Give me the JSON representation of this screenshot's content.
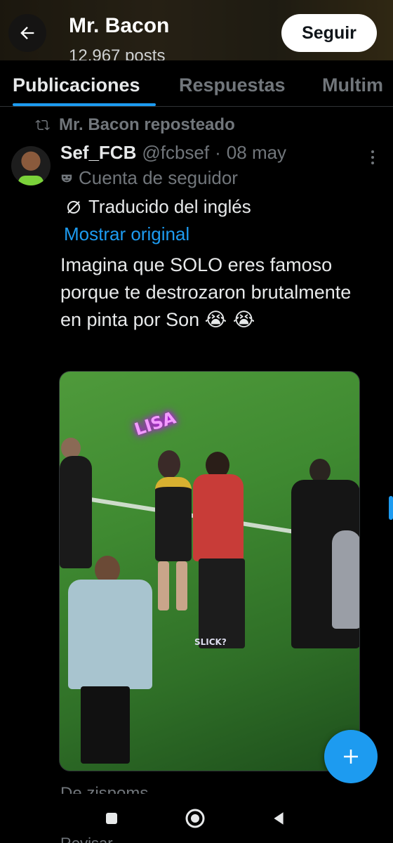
{
  "header": {
    "profile_name": "Mr. Bacon",
    "posts_count": "12.967 posts",
    "follow_label": "Seguir"
  },
  "tabs": [
    {
      "label": "Publicaciones",
      "active": true
    },
    {
      "label": "Respuestas",
      "active": false
    },
    {
      "label": "Multim",
      "active": false
    }
  ],
  "post": {
    "repost_label": "Mr. Bacon reposteado",
    "author_name": "Sef_FCB",
    "author_handle": "@fcbsef",
    "separator": "·",
    "date": "08 may",
    "fan_account_label": "Cuenta de seguidor",
    "translated_label": "Traducido del inglés",
    "show_original_label": "Mostrar original",
    "text": "Imagina que SOLO eres famoso porque te destrozaron brutalmente en pinta por Son",
    "emoji": "😭 😭",
    "media_overlay_tag": "LISA",
    "media_watermark": "SLICK?",
    "source_label": "De zispoms"
  },
  "bottom_text": "Revisar",
  "icons": {
    "back": "back-arrow-icon",
    "repost": "repost-icon",
    "more": "more-vertical-icon",
    "fan": "mask-icon",
    "translate": "translate-icon",
    "compose": "plus-icon"
  },
  "colors": {
    "accent": "#1d9bf0",
    "background": "#000000",
    "secondary_text": "#71767b"
  }
}
